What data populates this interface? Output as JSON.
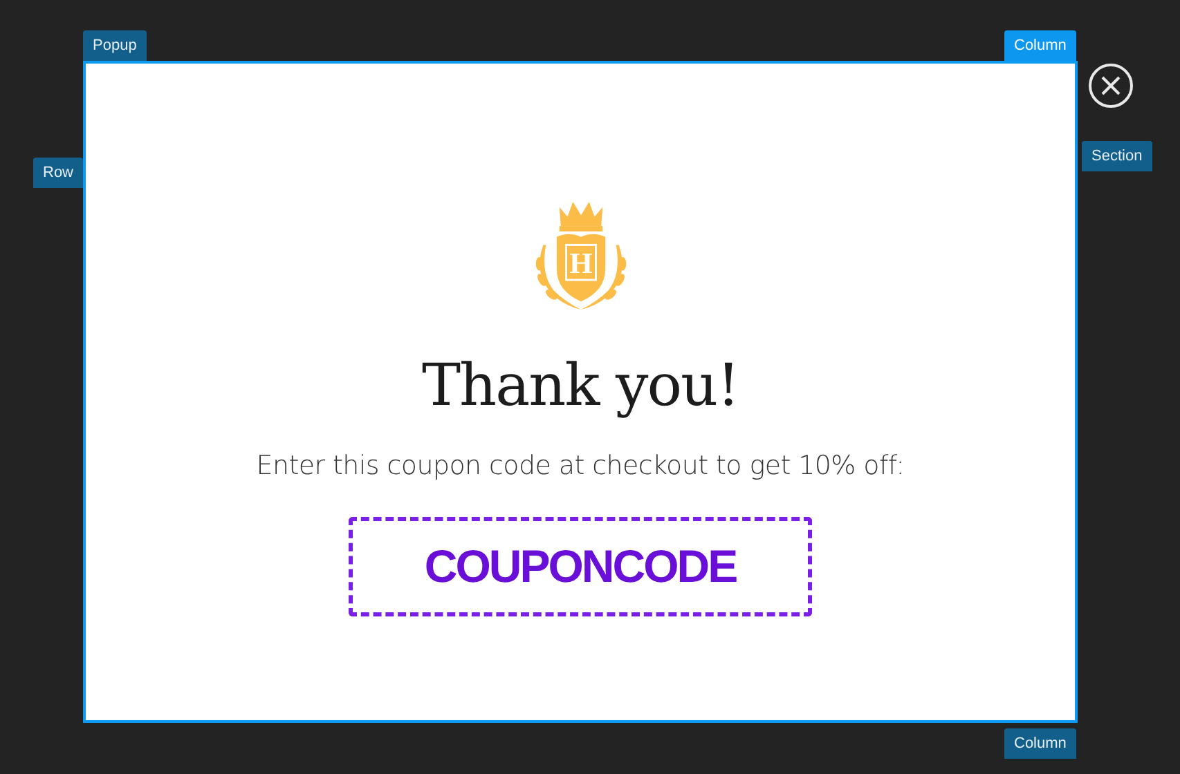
{
  "overlay_labels": [
    {
      "kind": "popup",
      "text": "Popup",
      "selected": false
    },
    {
      "kind": "column-top",
      "text": "Column",
      "selected": true
    },
    {
      "kind": "row",
      "text": "Row",
      "selected": false
    },
    {
      "kind": "section",
      "text": "Section",
      "selected": false
    },
    {
      "kind": "column-bottom",
      "text": "Column",
      "selected": false
    }
  ],
  "popup": {
    "logo_letter": "H",
    "heading": "Thank you!",
    "message": "Enter this coupon code at checkout to get 10% off:",
    "coupon_code": "COUPONCODE"
  }
}
